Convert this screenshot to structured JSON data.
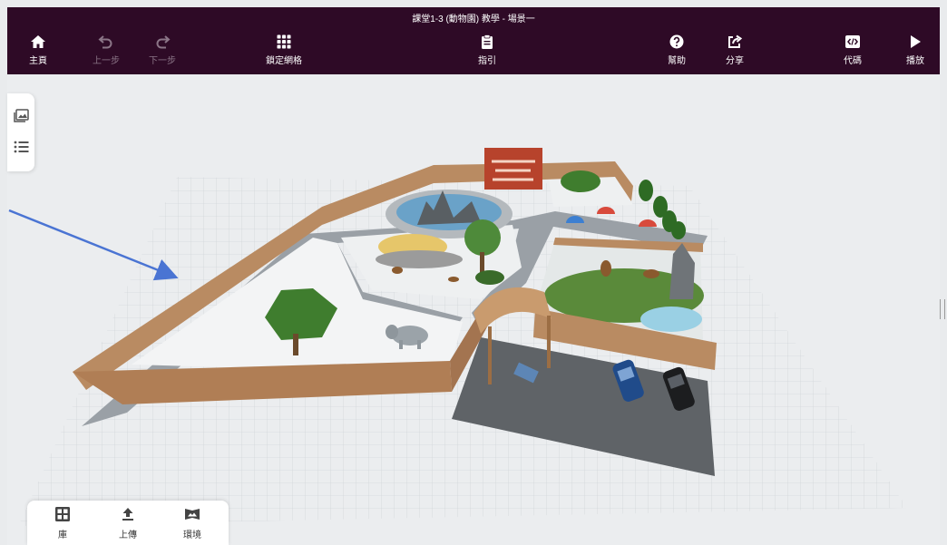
{
  "document": {
    "title": "課堂1-3 (動物園) 教學 - 場景一"
  },
  "toolbar": {
    "home": "主頁",
    "undo": "上一步",
    "redo": "下一步",
    "lock_grid": "鎖定網格",
    "guide": "指引",
    "help": "幫助",
    "share": "分享",
    "code": "代碼",
    "play": "播放"
  },
  "side_panel": {
    "items": [
      "images-icon",
      "list-icon"
    ]
  },
  "bottom_panel": {
    "library": "庫",
    "upload": "上傳",
    "environment": "環境"
  },
  "colors": {
    "toolbar_bg": "#2e0a26",
    "toolbar_disabled": "#8b7587",
    "annotation_arrow": "#4a74d3",
    "fence": "#b98b62",
    "path": "#9aa0a6"
  },
  "scene": {
    "objects": [
      "zoo-fence",
      "walking-path",
      "pond",
      "elephant",
      "trees",
      "bears",
      "tunnel",
      "blue-car",
      "black-car",
      "sign-board",
      "parasols",
      "parking-lot"
    ]
  }
}
